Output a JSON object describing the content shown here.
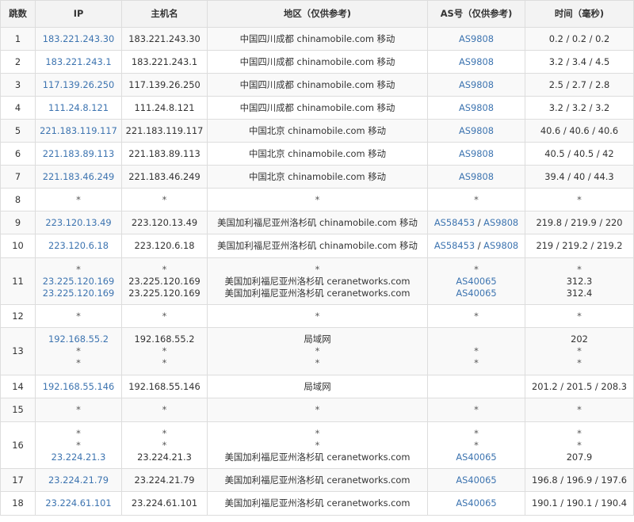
{
  "columns": {
    "hop": "跳数",
    "ip": "IP",
    "host": "主机名",
    "region": "地区（仅供参考)",
    "asn": "AS号（仅供参考)",
    "time": "时间（毫秒)"
  },
  "rows": [
    {
      "hop": "1",
      "ip": [
        "183.221.243.30"
      ],
      "host": [
        "183.221.243.30"
      ],
      "region": [
        "中国四川成都 chinamobile.com 移动"
      ],
      "asn": [
        [
          "AS9808"
        ]
      ],
      "time": [
        "0.2 / 0.2 / 0.2"
      ]
    },
    {
      "hop": "2",
      "ip": [
        "183.221.243.1"
      ],
      "host": [
        "183.221.243.1"
      ],
      "region": [
        "中国四川成都 chinamobile.com 移动"
      ],
      "asn": [
        [
          "AS9808"
        ]
      ],
      "time": [
        "3.2 / 3.4 / 4.5"
      ]
    },
    {
      "hop": "3",
      "ip": [
        "117.139.26.250"
      ],
      "host": [
        "117.139.26.250"
      ],
      "region": [
        "中国四川成都 chinamobile.com 移动"
      ],
      "asn": [
        [
          "AS9808"
        ]
      ],
      "time": [
        "2.5 / 2.7 / 2.8"
      ]
    },
    {
      "hop": "4",
      "ip": [
        "111.24.8.121"
      ],
      "host": [
        "111.24.8.121"
      ],
      "region": [
        "中国四川成都 chinamobile.com 移动"
      ],
      "asn": [
        [
          "AS9808"
        ]
      ],
      "time": [
        "3.2 / 3.2 / 3.2"
      ]
    },
    {
      "hop": "5",
      "ip": [
        "221.183.119.117"
      ],
      "host": [
        "221.183.119.117"
      ],
      "region": [
        "中国北京 chinamobile.com 移动"
      ],
      "asn": [
        [
          "AS9808"
        ]
      ],
      "time": [
        "40.6 / 40.6 / 40.6"
      ]
    },
    {
      "hop": "6",
      "ip": [
        "221.183.89.113"
      ],
      "host": [
        "221.183.89.113"
      ],
      "region": [
        "中国北京 chinamobile.com 移动"
      ],
      "asn": [
        [
          "AS9808"
        ]
      ],
      "time": [
        "40.5 / 40.5 / 42"
      ]
    },
    {
      "hop": "7",
      "ip": [
        "221.183.46.249"
      ],
      "host": [
        "221.183.46.249"
      ],
      "region": [
        "中国北京 chinamobile.com 移动"
      ],
      "asn": [
        [
          "AS9808"
        ]
      ],
      "time": [
        "39.4 / 40 / 44.3"
      ]
    },
    {
      "hop": "8",
      "ip": [
        "*"
      ],
      "host": [
        "*"
      ],
      "region": [
        "*"
      ],
      "asn": [
        [
          "*"
        ]
      ],
      "time": [
        "*"
      ]
    },
    {
      "hop": "9",
      "ip": [
        "223.120.13.49"
      ],
      "host": [
        "223.120.13.49"
      ],
      "region": [
        "美国加利福尼亚州洛杉矶 chinamobile.com 移动"
      ],
      "asn": [
        [
          "AS58453",
          "AS9808"
        ]
      ],
      "time": [
        "219.8 / 219.9 / 220"
      ]
    },
    {
      "hop": "10",
      "ip": [
        "223.120.6.18"
      ],
      "host": [
        "223.120.6.18"
      ],
      "region": [
        "美国加利福尼亚州洛杉矶 chinamobile.com 移动"
      ],
      "asn": [
        [
          "AS58453",
          "AS9808"
        ]
      ],
      "time": [
        "219 / 219.2 / 219.2"
      ]
    },
    {
      "hop": "11",
      "ip": [
        "*",
        "23.225.120.169",
        "23.225.120.169"
      ],
      "host": [
        "*",
        "23.225.120.169",
        "23.225.120.169"
      ],
      "region": [
        "*",
        "美国加利福尼亚州洛杉矶 ceranetworks.com",
        "美国加利福尼亚州洛杉矶 ceranetworks.com"
      ],
      "asn": [
        [
          "*"
        ],
        [
          "AS40065"
        ],
        [
          "AS40065"
        ]
      ],
      "time": [
        "*",
        "312.3",
        "312.4"
      ]
    },
    {
      "hop": "12",
      "ip": [
        "*"
      ],
      "host": [
        "*"
      ],
      "region": [
        "*"
      ],
      "asn": [
        [
          "*"
        ]
      ],
      "time": [
        "*"
      ]
    },
    {
      "hop": "13",
      "ip": [
        "192.168.55.2",
        "*",
        "*"
      ],
      "host": [
        "192.168.55.2",
        "*",
        "*"
      ],
      "region": [
        "局域网",
        "*",
        "*"
      ],
      "asn": [
        [],
        [
          "*"
        ],
        [
          "*"
        ]
      ],
      "time": [
        "202",
        "*",
        "*"
      ]
    },
    {
      "hop": "14",
      "ip": [
        "192.168.55.146"
      ],
      "host": [
        "192.168.55.146"
      ],
      "region": [
        "局域网"
      ],
      "asn": [
        []
      ],
      "time": [
        "201.2 / 201.5 / 208.3"
      ]
    },
    {
      "hop": "15",
      "ip": [
        "*"
      ],
      "host": [
        "*"
      ],
      "region": [
        "*"
      ],
      "asn": [
        [
          "*"
        ]
      ],
      "time": [
        "*"
      ]
    },
    {
      "hop": "16",
      "ip": [
        "*",
        "*",
        "23.224.21.3"
      ],
      "host": [
        "*",
        "*",
        "23.224.21.3"
      ],
      "region": [
        "*",
        "*",
        "美国加利福尼亚州洛杉矶 ceranetworks.com"
      ],
      "asn": [
        [
          "*"
        ],
        [
          "*"
        ],
        [
          "AS40065"
        ]
      ],
      "time": [
        "*",
        "*",
        "207.9"
      ]
    },
    {
      "hop": "17",
      "ip": [
        "23.224.21.79"
      ],
      "host": [
        "23.224.21.79"
      ],
      "region": [
        "美国加利福尼亚州洛杉矶 ceranetworks.com"
      ],
      "asn": [
        [
          "AS40065"
        ]
      ],
      "time": [
        "196.8 / 196.9 / 197.6"
      ]
    },
    {
      "hop": "18",
      "ip": [
        "23.224.61.101"
      ],
      "host": [
        "23.224.61.101"
      ],
      "region": [
        "美国加利福尼亚州洛杉矶 ceranetworks.com"
      ],
      "asn": [
        [
          "AS40065"
        ]
      ],
      "time": [
        "190.1 / 190.1 / 190.4"
      ]
    }
  ],
  "colors": {
    "link": "#3d74b0",
    "border": "#dddddd",
    "header_bg": "#f3f3f3",
    "stripe_bg": "#f9f9f9",
    "text": "#333333"
  }
}
